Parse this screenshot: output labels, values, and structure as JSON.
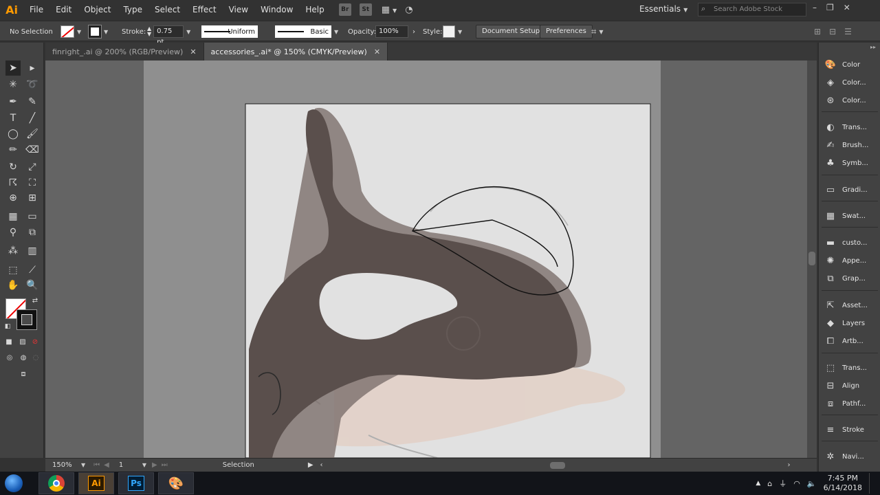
{
  "app": {
    "logo": "Ai"
  },
  "menu": [
    "File",
    "Edit",
    "Object",
    "Type",
    "Select",
    "Effect",
    "View",
    "Window",
    "Help"
  ],
  "app_buttons": [
    "Br",
    "St"
  ],
  "workspace": {
    "label": "Essentials"
  },
  "search": {
    "placeholder": "Search Adobe Stock"
  },
  "control": {
    "selection_label": "No Selection",
    "stroke_label": "Stroke:",
    "stroke_weight": "0.75 pt",
    "profile": "Uniform",
    "brush": "Basic",
    "opacity_label": "Opacity:",
    "opacity_value": "100%",
    "style_label": "Style:",
    "document_setup": "Document Setup",
    "preferences": "Preferences"
  },
  "tabs": [
    {
      "label": "finright_.ai @ 200% (RGB/Preview)",
      "active": false
    },
    {
      "label": "accessories_.ai* @ 150% (CMYK/Preview)",
      "active": true
    }
  ],
  "status": {
    "zoom": "150%",
    "artboard": "1",
    "tool": "Selection"
  },
  "panels": [
    "Color",
    "Color...",
    "Color...",
    "Trans...",
    "Brush...",
    "Symb...",
    "Gradi...",
    "Swat...",
    "custo...",
    "Appe...",
    "Grap...",
    "Asset...",
    "Layers",
    "Artb...",
    "Trans...",
    "Align",
    "Pathf...",
    "Stroke",
    "Navi..."
  ],
  "taskbar": {
    "time": "7:45 PM",
    "date": "6/14/2018",
    "apps": [
      "Chrome",
      "Ai",
      "Ps",
      "Paint"
    ]
  }
}
